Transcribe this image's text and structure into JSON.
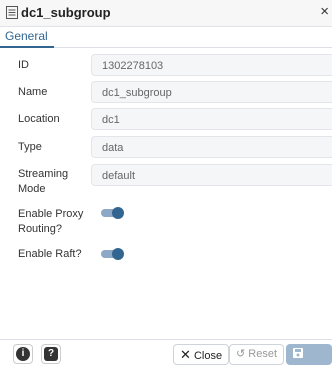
{
  "window": {
    "title": "dc1_subgroup",
    "close_label": "×"
  },
  "tabs": [
    {
      "label": "General"
    }
  ],
  "fields": {
    "id": {
      "label": "ID",
      "value": "1302278103"
    },
    "name": {
      "label": "Name",
      "value": "dc1_subgroup"
    },
    "location": {
      "label": "Location",
      "value": "dc1"
    },
    "type": {
      "label": "Type",
      "value": "data"
    },
    "streaming_mode": {
      "label": "Streaming Mode",
      "value": "default"
    }
  },
  "toggles": {
    "proxy_routing": {
      "label": "Enable Proxy Routing?",
      "on": true
    },
    "raft": {
      "label": "Enable Raft?",
      "on": true
    }
  },
  "footer": {
    "info_icon": "i",
    "help_icon": "?",
    "close_label": "Close",
    "reset_label": "Reset",
    "save_label": "Save"
  },
  "colors": {
    "accent": "#326690",
    "toggle_track": "#8da8c6",
    "save_disabled": "#9fb6cf"
  }
}
